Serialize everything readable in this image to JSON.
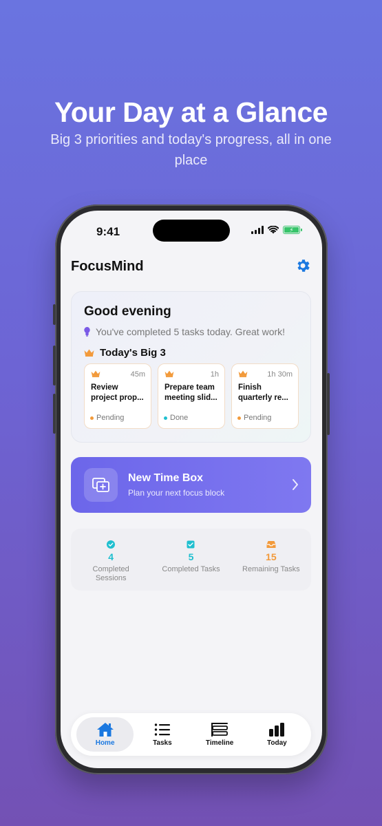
{
  "promo": {
    "headline": "Your Day at a Glance",
    "subline": "Big 3 priorities and today's progress, all in one place"
  },
  "status_bar": {
    "time": "9:41"
  },
  "app": {
    "title": "FocusMind",
    "settings_icon": "gear-icon"
  },
  "summary": {
    "greeting": "Good evening",
    "completed_message": "You've completed 5 tasks today. Great work!",
    "big3_title": "Today's Big 3",
    "tasks": [
      {
        "title": "Review project prop...",
        "duration": "45m",
        "status": "Pending",
        "status_color": "#f29a3b"
      },
      {
        "title": "Prepare team meeting slid...",
        "duration": "1h",
        "status": "Done",
        "status_color": "#1fbfcf"
      },
      {
        "title": "Finish quarterly re...",
        "duration": "1h 30m",
        "status": "Pending",
        "status_color": "#f29a3b"
      }
    ]
  },
  "new_time_box": {
    "title": "New Time Box",
    "subtitle": "Plan your next focus block"
  },
  "stats": [
    {
      "value": "4",
      "label": "Completed Sessions",
      "color": "#1fbfcf",
      "icon": "check-circle-icon"
    },
    {
      "value": "5",
      "label": "Completed Tasks",
      "color": "#1fbfcf",
      "icon": "checkbox-icon"
    },
    {
      "value": "15",
      "label": "Remaining Tasks",
      "color": "#f29a3b",
      "icon": "inbox-icon"
    }
  ],
  "tabs": [
    {
      "label": "Home",
      "icon": "house-icon",
      "active": true
    },
    {
      "label": "Tasks",
      "icon": "list-icon",
      "active": false
    },
    {
      "label": "Timeline",
      "icon": "timeline-icon",
      "active": false
    },
    {
      "label": "Today",
      "icon": "bar-chart-icon",
      "active": false
    }
  ],
  "colors": {
    "accent": "#1a78e0",
    "primary_button": "#6c66ea",
    "pending": "#f29a3b",
    "done": "#1fbfcf"
  }
}
